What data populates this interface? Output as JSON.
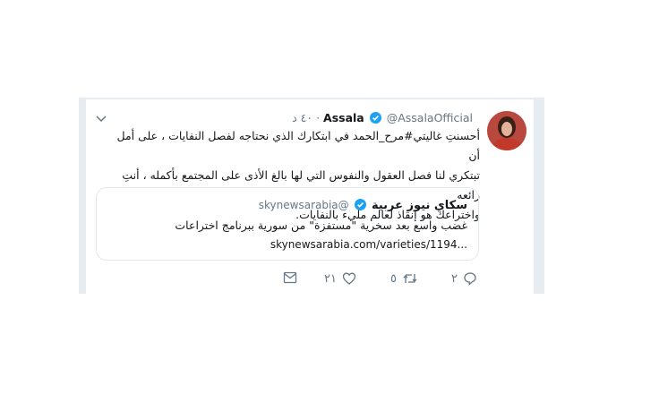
{
  "tweet": {
    "author_name": "Assala",
    "author_handle": "@AssalaOfficial",
    "time": "٤٠ د",
    "separator": "·",
    "lines": [
      "أحسنتِ غاليتي#مرح_الحمد في ابتكارك الذي نحتاجه لفصل النفايات ، على أمل أن",
      "تبتكري لنا فصل العقول والنفوس التي لها بالغ الأذى على المجتمع بأكمله ، أنتِ رائعه",
      "واختراعك هو إنقاذ لعالم مليء بالنفايات."
    ],
    "verified": true
  },
  "quote": {
    "name": "سكاي نيوز عربية",
    "handle": "@skynewsarabia",
    "text": "غضب واسع بعد سخرية \"مستفزة\" من سورية ببرنامج اختراعات",
    "link": "skynewsarabia.com/varieties/1194..."
  },
  "actions": {
    "reply_count": "٢",
    "retweet_count": "٥",
    "like_count": "٢١"
  },
  "colors": {
    "accent": "#1da1f2",
    "muted": "#657786",
    "text": "#14171a"
  },
  "icons": [
    "chevron-down-icon",
    "verified-icon",
    "reply-icon",
    "retweet-icon",
    "like-icon",
    "message-icon"
  ]
}
